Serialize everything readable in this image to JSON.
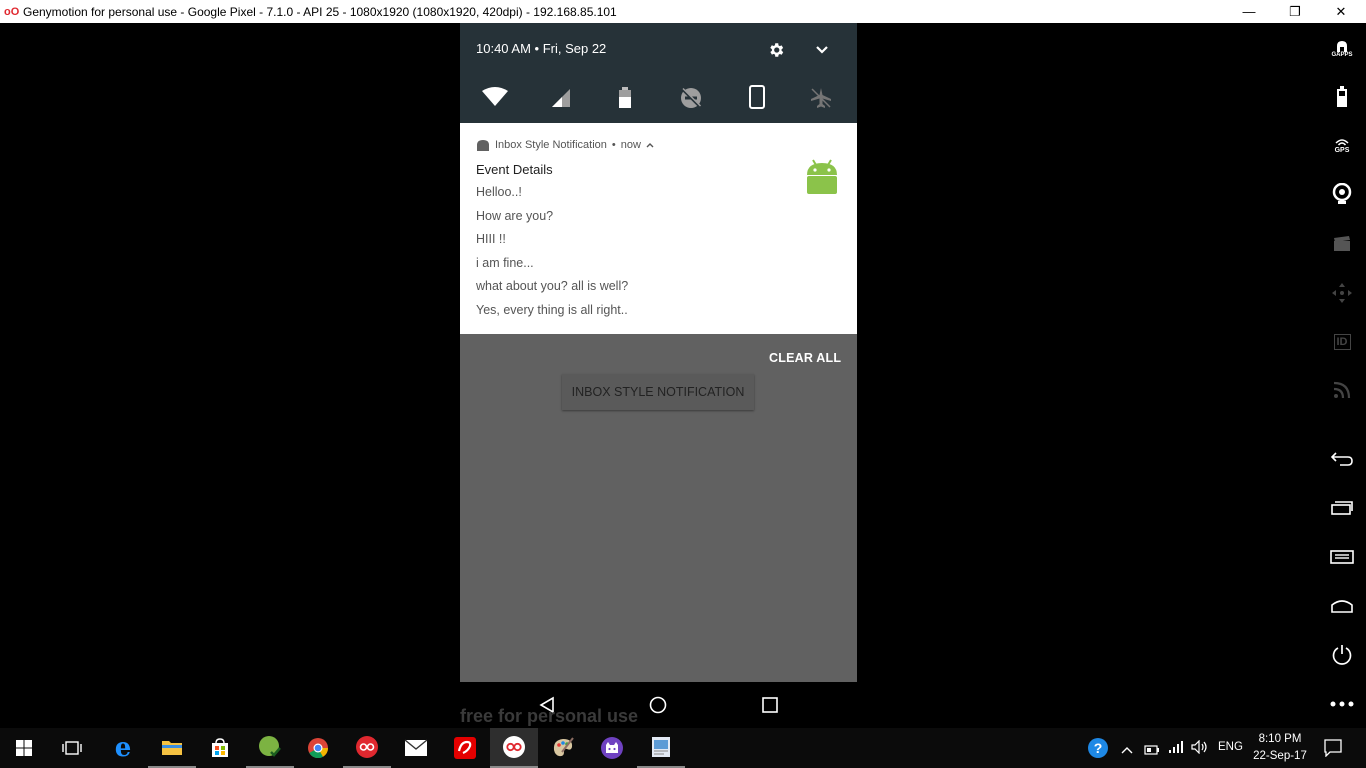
{
  "window": {
    "title": "Genymotion for personal use - Google Pixel - 7.1.0 - API 25 - 1080x1920 (1080x1920, 420dpi) - 192.168.85.101",
    "logo_text": "oO",
    "minimize_glyph": "—",
    "maximize_glyph": "❐",
    "close_glyph": "✕"
  },
  "quick_settings": {
    "time_date": "10:40 AM  •  Fri, Sep 22",
    "tiles": [
      "wifi-icon",
      "cellular-signal-icon",
      "battery-icon",
      "do-not-disturb-off-icon",
      "portrait-rotation-icon",
      "airplane-mode-off-icon"
    ],
    "settings_icon": "gear-icon",
    "expand_icon": "chevron-down-icon"
  },
  "notification": {
    "app_name": "Inbox Style Notification",
    "separator": "•",
    "time": "now",
    "title": "Event Details",
    "lines": [
      "Helloo..!",
      "How are you?",
      "HIII !!",
      "i am fine...",
      "what about you? all is well?",
      "Yes, every thing is all right.."
    ],
    "large_icon": "android-robot-icon"
  },
  "shade": {
    "clear_all_label": "CLEAR ALL"
  },
  "app": {
    "button_label": "INBOX STYLE NOTIFICATION"
  },
  "nav_bar": [
    "back-icon",
    "home-icon",
    "recents-icon"
  ],
  "watermark": "free for personal use",
  "genymotion_sidebar": [
    "GAPPS",
    "battery",
    "GPS",
    "webcam",
    "capture",
    "remote-control",
    "identifiers",
    "network",
    "back",
    "recent-apps",
    "menu",
    "home",
    "power",
    "more"
  ],
  "sidebar_gapps_label": "GAPPS",
  "sidebar_gps_label": "GPS",
  "sidebar_id_label": "ID",
  "taskbar": {
    "apps": [
      "start",
      "task-view",
      "edge",
      "file-explorer",
      "store",
      "greenshot",
      "chrome",
      "genymotion-shell",
      "mail",
      "airtel",
      "genymotion",
      "paint",
      "github",
      "photos"
    ],
    "tray": {
      "language": "ENG",
      "time": "8:10 PM",
      "date": "22-Sep-17"
    }
  },
  "colors": {
    "qs_background": "#263238",
    "shade_dim": "#616161",
    "android_green": "#8BC34A",
    "genymotion_red": "#e0282f"
  }
}
